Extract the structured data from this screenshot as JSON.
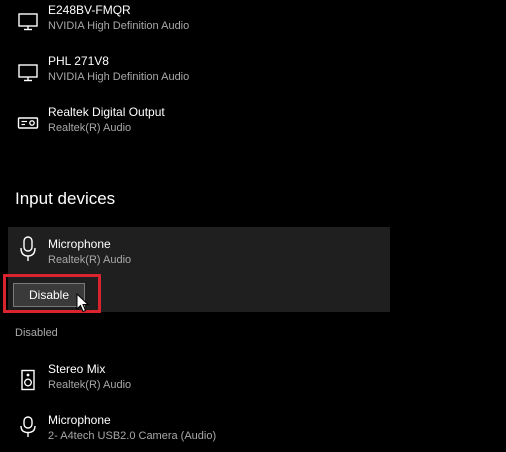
{
  "output_devices": [
    {
      "name": "E248BV-FMQR",
      "sub": "NVIDIA High Definition Audio",
      "icon": "monitor-icon"
    },
    {
      "name": "PHL 271V8",
      "sub": "NVIDIA High Definition Audio",
      "icon": "monitor-icon"
    },
    {
      "name": "Realtek Digital Output",
      "sub": "Realtek(R) Audio",
      "icon": "digital-output-icon"
    }
  ],
  "input_section": {
    "title": "Input devices",
    "selected_device": {
      "name": "Microphone",
      "sub": "Realtek(R) Audio",
      "icon": "microphone-icon"
    },
    "disable_button_label": "Disable"
  },
  "disabled_section": {
    "label": "Disabled",
    "devices": [
      {
        "name": "Stereo Mix",
        "sub": "Realtek(R) Audio",
        "icon": "speaker-icon"
      },
      {
        "name": "Microphone",
        "sub": "2- A4tech USB2.0 Camera (Audio)",
        "icon": "microphone-icon"
      }
    ]
  },
  "colors": {
    "background": "#000000",
    "panel": "#1f1f1f",
    "secondary_text": "#a8a8a8",
    "highlight": "#d9232d"
  }
}
